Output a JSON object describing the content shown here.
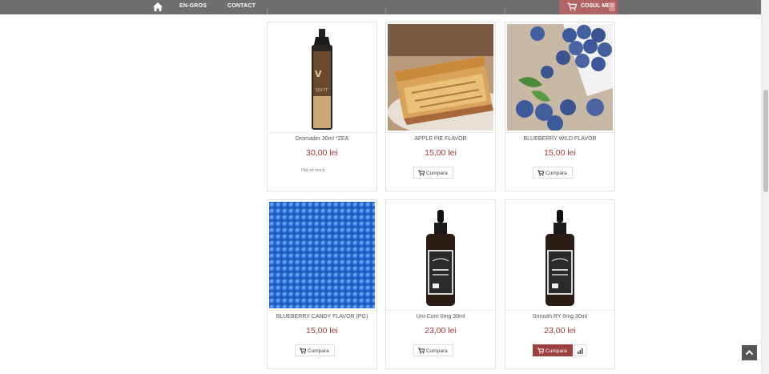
{
  "nav": {
    "home_icon": "home-icon",
    "links": [
      "EN-GROS",
      "CONTACT"
    ],
    "cart_label": "COSUL MEU",
    "cart_count": "0"
  },
  "products": [
    {
      "name": "Dromader 30ml *ZEA",
      "price": "30,00 lei",
      "stock": "Out of stock",
      "image": "bottle-vaperus-quit"
    },
    {
      "name": "APPLE PIE FLAVOR",
      "price": "15,00 lei",
      "buy_label": "Cumpara",
      "image": "apple-pie"
    },
    {
      "name": "BLUEBERRY WILD FLAVOR",
      "price": "15,00 lei",
      "buy_label": "Cumpara",
      "image": "blueberries"
    },
    {
      "name": "BLUEBERRY CANDY FLAVOR (PG)",
      "price": "15,00 lei",
      "buy_label": "Cumpara",
      "image": "blue-candy-beads"
    },
    {
      "name": "Uni-Corn 0mg 30ml",
      "price": "23,00 lei",
      "buy_label": "Cumpara",
      "image": "dropper-bottle"
    },
    {
      "name": "Smooth RY 0mg 30ml",
      "price": "23,00 lei",
      "buy_label": "Cumpara",
      "image": "dropper-bottle"
    }
  ],
  "colors": {
    "topbar": "#6e6e6e",
    "accent": "#9c4040",
    "price": "#a03a3a"
  }
}
